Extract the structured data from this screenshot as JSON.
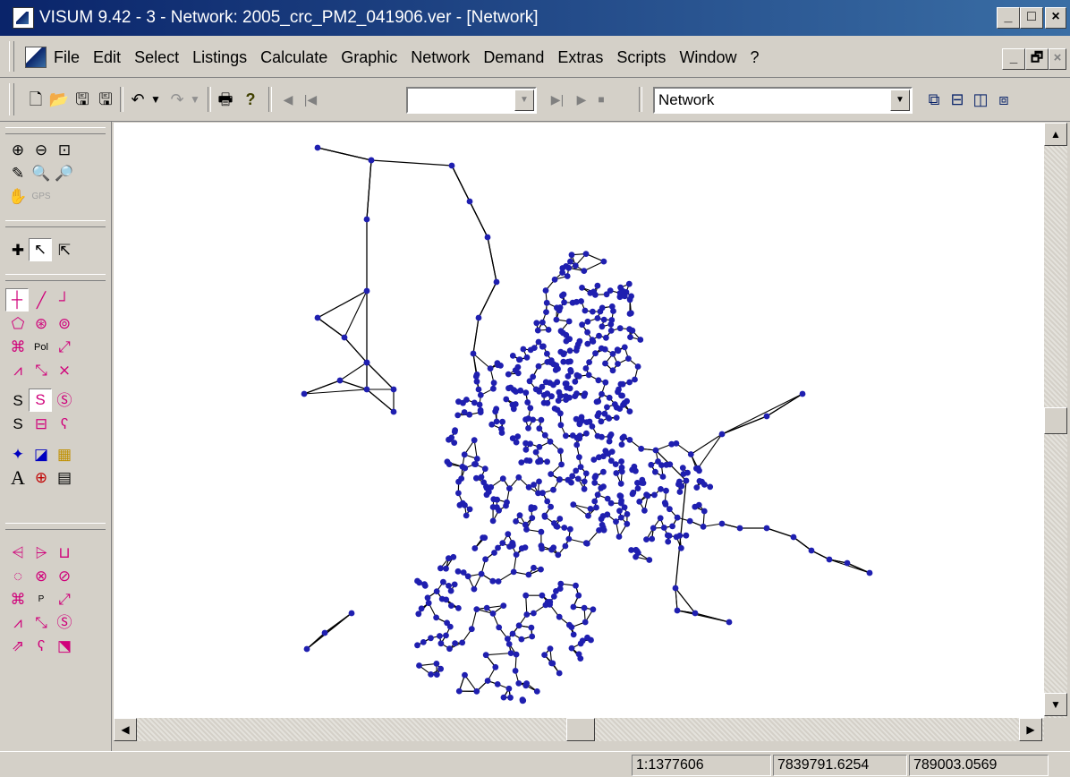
{
  "window": {
    "title": "VISUM 9.42 - 3 - Network: 2005_crc_PM2_041906.ver - [Network]"
  },
  "window_controls": {
    "minimize": "_",
    "maximize": "□",
    "close": "×"
  },
  "menu": {
    "items": [
      "File",
      "Edit",
      "Select",
      "Listings",
      "Calculate",
      "Graphic",
      "Network",
      "Demand",
      "Extras",
      "Scripts",
      "Window",
      "?"
    ]
  },
  "mdi_controls": {
    "minimize": "_",
    "restore": "🗗",
    "close": "×"
  },
  "toolbar": {
    "view_combo_value": "Network",
    "nav_combo_value": ""
  },
  "statusbar": {
    "scale": "1:1377606",
    "x_coord": "7839791.6254",
    "y_coord": "789003.0569"
  },
  "colors": {
    "node": "#1f1fb0",
    "link": "#000000",
    "titlebar_start": "#0a246a",
    "titlebar_end": "#3a6ea5",
    "palette_accent": "#d0007a"
  },
  "tools": {
    "text_tool": "A",
    "pol_tool": "Pol",
    "spot_glyph": "S"
  }
}
